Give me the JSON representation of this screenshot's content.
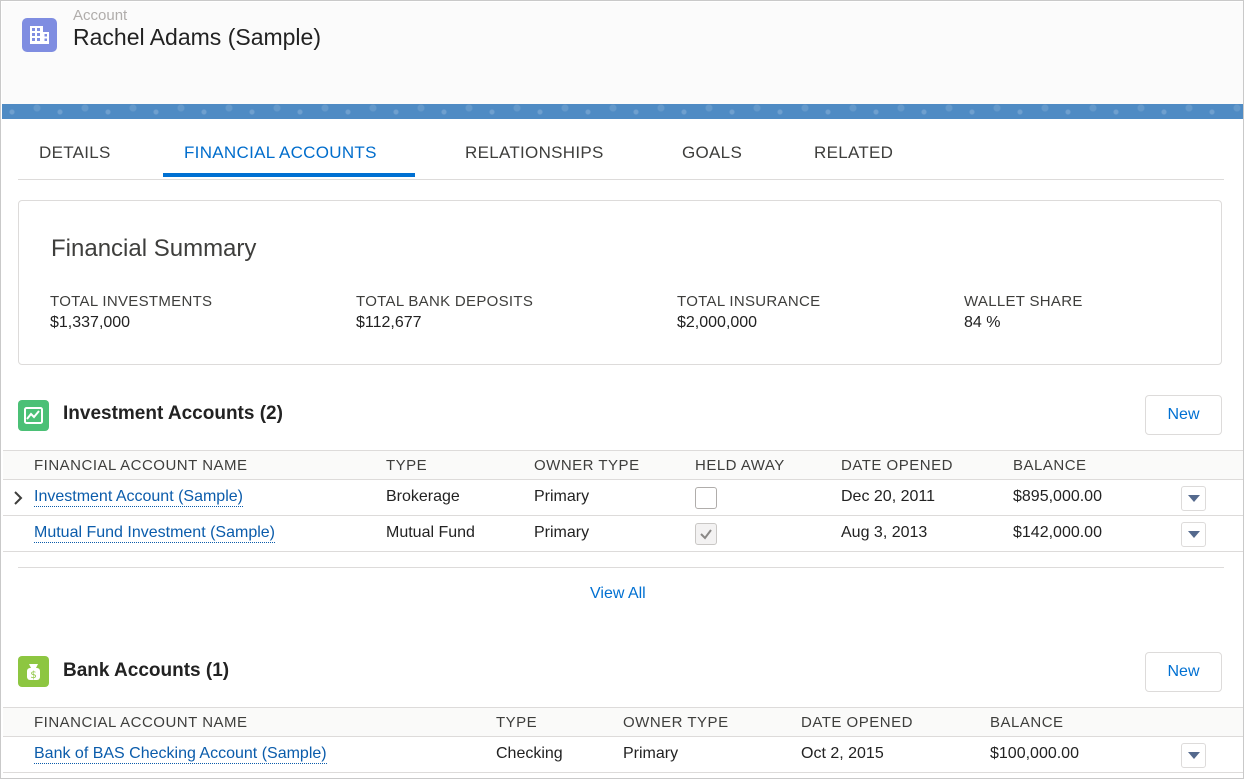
{
  "header": {
    "object_label": "Account",
    "record_name": "Rachel Adams (Sample)"
  },
  "tabs": [
    {
      "label": "DETAILS",
      "active": false
    },
    {
      "label": "FINANCIAL ACCOUNTS",
      "active": true
    },
    {
      "label": "RELATIONSHIPS",
      "active": false
    },
    {
      "label": "GOALS",
      "active": false
    },
    {
      "label": "RELATED",
      "active": false
    }
  ],
  "summary": {
    "title": "Financial Summary",
    "metrics": [
      {
        "label": "TOTAL INVESTMENTS",
        "value": "$1,337,000"
      },
      {
        "label": "TOTAL BANK DEPOSITS",
        "value": "$112,677"
      },
      {
        "label": "TOTAL INSURANCE",
        "value": "$2,000,000"
      },
      {
        "label": "WALLET SHARE",
        "value": "84 %"
      }
    ]
  },
  "investment": {
    "title": "Investment Accounts (2)",
    "new_label": "New",
    "icon_color": "#4bc076",
    "columns": [
      "FINANCIAL ACCOUNT NAME",
      "TYPE",
      "OWNER TYPE",
      "HELD AWAY",
      "DATE OPENED",
      "BALANCE"
    ],
    "rows": [
      {
        "name": "Investment Account (Sample)",
        "type": "Brokerage",
        "owner": "Primary",
        "held_away": false,
        "date": "Dec 20, 2011",
        "balance": "$895,000.00"
      },
      {
        "name": "Mutual Fund Investment (Sample)",
        "type": "Mutual Fund",
        "owner": "Primary",
        "held_away": true,
        "date": "Aug 3, 2013",
        "balance": "$142,000.00"
      }
    ],
    "view_all": "View All"
  },
  "bank": {
    "title": "Bank Accounts (1)",
    "new_label": "New",
    "icon_color": "#8dc641",
    "columns": [
      "FINANCIAL ACCOUNT NAME",
      "TYPE",
      "OWNER TYPE",
      "DATE OPENED",
      "BALANCE"
    ],
    "rows": [
      {
        "name": "Bank of BAS Checking Account (Sample)",
        "type": "Checking",
        "owner": "Primary",
        "date": "Oct 2, 2015",
        "balance": "$100,000.00"
      }
    ]
  },
  "colors": {
    "accent": "#0070d2",
    "banner": "#4f8bc4",
    "account_icon": "#7f8de1"
  }
}
